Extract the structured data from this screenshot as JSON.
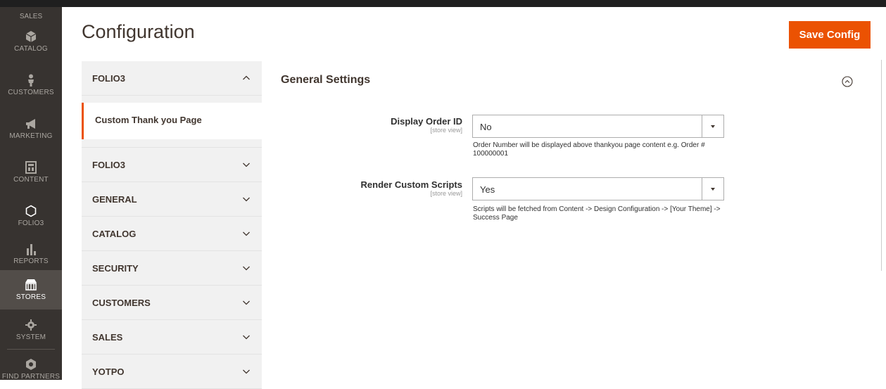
{
  "page_title": "Configuration",
  "save_button": "Save Config",
  "sidebar": {
    "top_label": "SALES",
    "items": [
      {
        "label": "CATALOG",
        "icon": "cube-icon"
      },
      {
        "label": "CUSTOMERS",
        "icon": "person-icon"
      },
      {
        "label": "MARKETING",
        "icon": "megaphone-icon"
      },
      {
        "label": "CONTENT",
        "icon": "content-icon"
      },
      {
        "label": "FOLIO3",
        "icon": "hexagon-icon"
      },
      {
        "label": "REPORTS",
        "icon": "bar-chart-icon"
      },
      {
        "label": "STORES",
        "icon": "store-icon",
        "active": true
      },
      {
        "label": "SYSTEM",
        "icon": "gear-icon"
      },
      {
        "label": "FIND PARTNERS",
        "icon": "partners-icon"
      }
    ]
  },
  "tabs": {
    "expanded": {
      "label": "FOLIO3",
      "sub_item": "Custom Thank you Page"
    },
    "collapsed": [
      "FOLIO3",
      "GENERAL",
      "CATALOG",
      "SECURITY",
      "CUSTOMERS",
      "SALES",
      "YOTPO"
    ]
  },
  "section": {
    "title": "General Settings",
    "fields": [
      {
        "label": "Display Order ID",
        "scope": "[store view]",
        "value": "No",
        "note": "Order Number will be displayed above thankyou page content e.g. Order # 100000001"
      },
      {
        "label": "Render Custom Scripts",
        "scope": "[store view]",
        "value": "Yes",
        "note": "Scripts will be fetched from Content -> Design Configuration -> [Your Theme] -> Success Page"
      }
    ]
  },
  "colors": {
    "sidebar_bg": "#373330",
    "accent": "#eb5202",
    "tab_bg": "#f1f1f1"
  }
}
